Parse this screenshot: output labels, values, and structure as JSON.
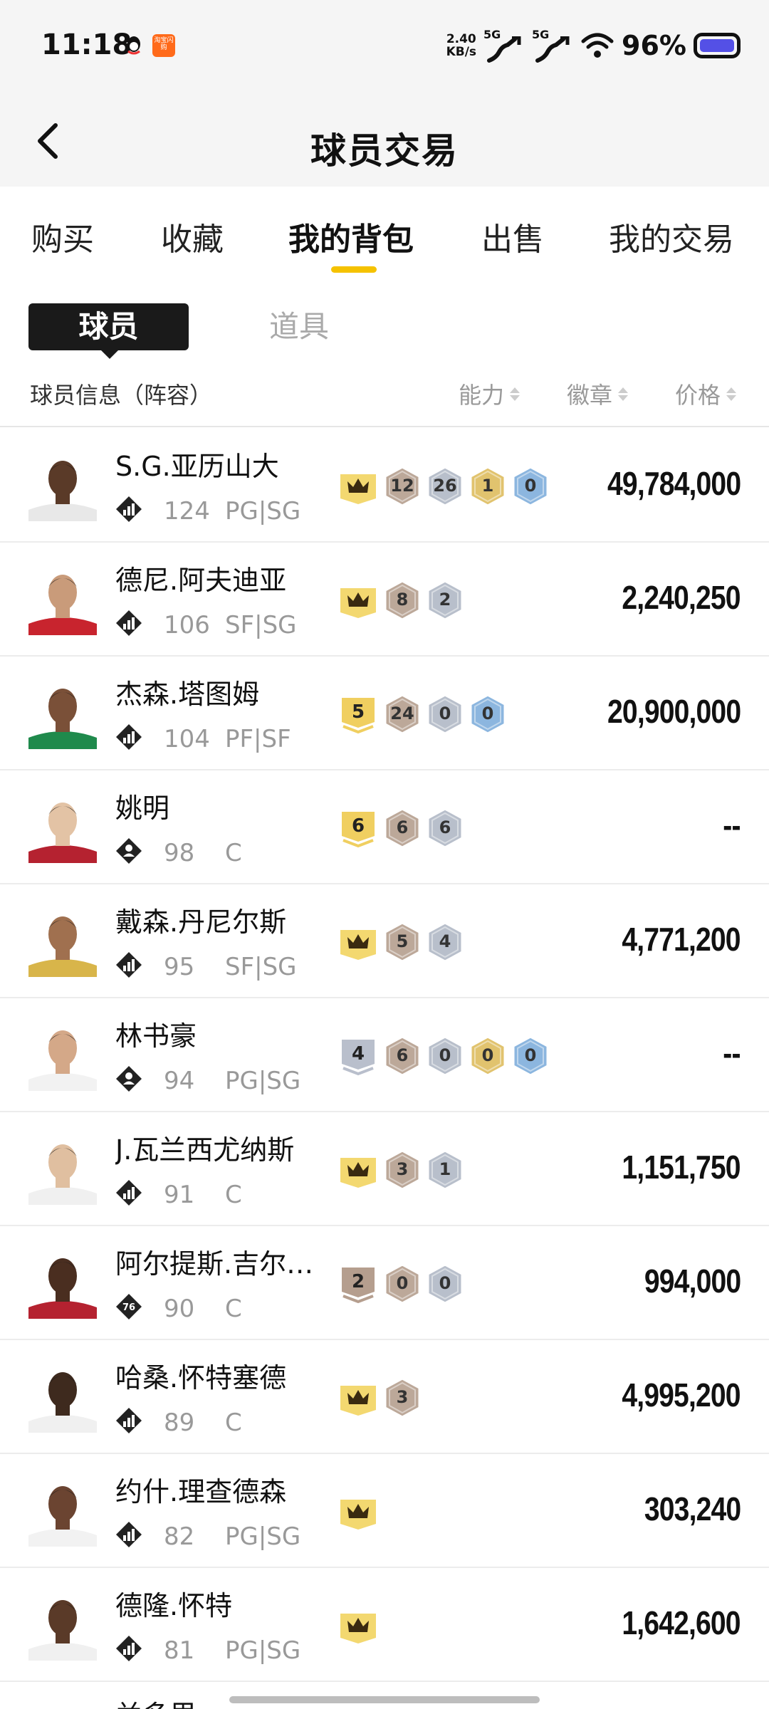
{
  "status_bar": {
    "time": "11:18",
    "net_speed_value": "2.40",
    "net_speed_unit": "KB/s",
    "signal_1": "5G",
    "signal_2": "5G",
    "battery": "96%",
    "taobao_label": "淘宝闪购",
    "icons": [
      "qq-icon",
      "taobao-flash-icon",
      "signal-icon",
      "wifi-icon",
      "battery-icon"
    ]
  },
  "header": {
    "title": "球员交易"
  },
  "tabs": [
    {
      "label": "购买"
    },
    {
      "label": "收藏"
    },
    {
      "label": "我的背包",
      "active": true
    },
    {
      "label": "出售"
    },
    {
      "label": "我的交易"
    }
  ],
  "subtabs": {
    "active": "球员",
    "other": "道具"
  },
  "columns": {
    "info": "球员信息（阵容）",
    "ability": "能力",
    "badge": "徽章",
    "price": "价格"
  },
  "colors": {
    "accent": "#f5c200",
    "gold_badge": "#e0c067",
    "bronze_badge": "#b9a494",
    "silver_badge": "#b5bcc9",
    "blue_badge": "#86b3de"
  },
  "players": [
    {
      "name": "S.G.亚历山大",
      "ability": "124",
      "position": "PG|SG",
      "price": "49,784,000",
      "tier": "crown",
      "badges": [
        {
          "type": "bronze",
          "n": "12"
        },
        {
          "type": "silver",
          "n": "26"
        },
        {
          "type": "gold",
          "n": "1"
        },
        {
          "type": "blue",
          "n": "0"
        }
      ],
      "pos_icon": "stats-icon"
    },
    {
      "name": "德尼.阿夫迪亚",
      "ability": "106",
      "position": "SF|SG",
      "price": "2,240,250",
      "tier": "crown",
      "badges": [
        {
          "type": "bronze",
          "n": "8"
        },
        {
          "type": "silver",
          "n": "2"
        }
      ],
      "pos_icon": "stats-icon"
    },
    {
      "name": "杰森.塔图姆",
      "ability": "104",
      "position": "PF|SF",
      "price": "20,900,000",
      "tier": "5",
      "badges": [
        {
          "type": "bronze",
          "n": "24"
        },
        {
          "type": "silver",
          "n": "0"
        },
        {
          "type": "blue",
          "n": "0"
        }
      ],
      "pos_icon": "stats-icon"
    },
    {
      "name": "姚明",
      "ability": "98",
      "position": "C",
      "price": "--",
      "tier": "6",
      "badges": [
        {
          "type": "bronze",
          "n": "6"
        },
        {
          "type": "silver",
          "n": "6"
        }
      ],
      "pos_icon": "person-icon"
    },
    {
      "name": "戴森.丹尼尔斯",
      "ability": "95",
      "position": "SF|SG",
      "price": "4,771,200",
      "tier": "crown",
      "badges": [
        {
          "type": "bronze",
          "n": "5"
        },
        {
          "type": "silver",
          "n": "4"
        }
      ],
      "pos_icon": "stats-icon"
    },
    {
      "name": "林书豪",
      "ability": "94",
      "position": "PG|SG",
      "price": "--",
      "tier": "4",
      "badges": [
        {
          "type": "bronze",
          "n": "6"
        },
        {
          "type": "silver",
          "n": "0"
        },
        {
          "type": "gold",
          "n": "0"
        },
        {
          "type": "blue",
          "n": "0"
        }
      ],
      "pos_icon": "person-icon"
    },
    {
      "name": "J.瓦兰西尤纳斯",
      "ability": "91",
      "position": "C",
      "price": "1,151,750",
      "tier": "crown",
      "badges": [
        {
          "type": "bronze",
          "n": "3"
        },
        {
          "type": "silver",
          "n": "1"
        }
      ],
      "pos_icon": "stats-icon"
    },
    {
      "name": "阿尔提斯.吉尔…",
      "ability": "90",
      "position": "C",
      "price": "994,000",
      "tier": "2",
      "badges": [
        {
          "type": "bronze",
          "n": "0"
        },
        {
          "type": "silver",
          "n": "0"
        }
      ],
      "pos_icon": "76-icon",
      "pos_icon_text": "76"
    },
    {
      "name": "哈桑.怀特塞德",
      "ability": "89",
      "position": "C",
      "price": "4,995,200",
      "tier": "crown",
      "badges": [
        {
          "type": "bronze",
          "n": "3"
        }
      ],
      "pos_icon": "stats-icon"
    },
    {
      "name": "约什.理查德森",
      "ability": "82",
      "position": "PG|SG",
      "price": "303,240",
      "tier": "crown",
      "badges": [],
      "pos_icon": "stats-icon"
    },
    {
      "name": "德隆.怀特",
      "ability": "81",
      "position": "PG|SG",
      "price": "1,642,600",
      "tier": "crown",
      "badges": [],
      "pos_icon": "stats-icon"
    }
  ],
  "partial_row_name": "兰多里"
}
